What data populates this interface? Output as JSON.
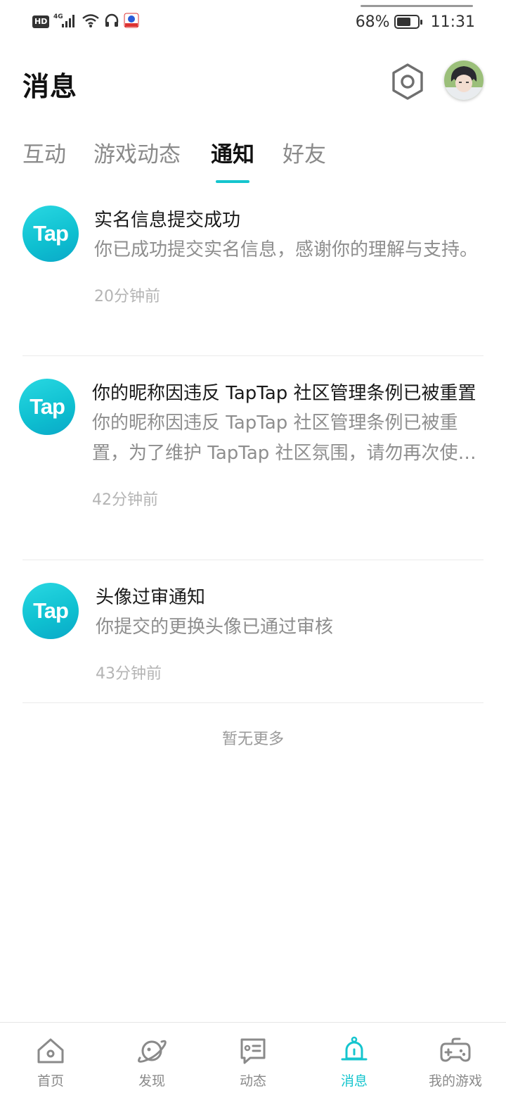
{
  "status_bar": {
    "hd": "HD",
    "network": "4G",
    "battery_text": "68%",
    "battery_level": 0.68,
    "time": "11:31"
  },
  "header": {
    "title": "消息"
  },
  "tabs": [
    {
      "label": "互动",
      "active": false
    },
    {
      "label": "游戏动态",
      "active": false
    },
    {
      "label": "通知",
      "active": true
    },
    {
      "label": "好友",
      "active": false
    }
  ],
  "notifications": [
    {
      "logo_text": "Tap",
      "title": "实名信息提交成功",
      "text": "你已成功提交实名信息，感谢你的理解与支持。",
      "time": "20分钟前"
    },
    {
      "logo_text": "Tap",
      "title": "你的昵称因违反 TapTap 社区管理条例已被重置",
      "text": "你的昵称因违反 TapTap 社区管理条例已被重置，为了维护 TapTap 社区氛围，请勿再次使用违规昵称",
      "time": "42分钟前"
    },
    {
      "logo_text": "Tap",
      "title": "头像过审通知",
      "text": "你提交的更换头像已通过审核",
      "time": "43分钟前"
    }
  ],
  "list_footer": "暂无更多",
  "bottom_nav": [
    {
      "label": "首页",
      "icon": "home-icon",
      "active": false
    },
    {
      "label": "发现",
      "icon": "planet-icon",
      "active": false
    },
    {
      "label": "动态",
      "icon": "chat-icon",
      "active": false
    },
    {
      "label": "消息",
      "icon": "bell-icon",
      "active": true
    },
    {
      "label": "我的游戏",
      "icon": "gamepad-icon",
      "active": false
    }
  ],
  "colors": {
    "accent": "#15c5ce",
    "text_primary": "#1a1a1a",
    "text_secondary": "#8e8e8e",
    "text_muted": "#b4b4b4"
  }
}
